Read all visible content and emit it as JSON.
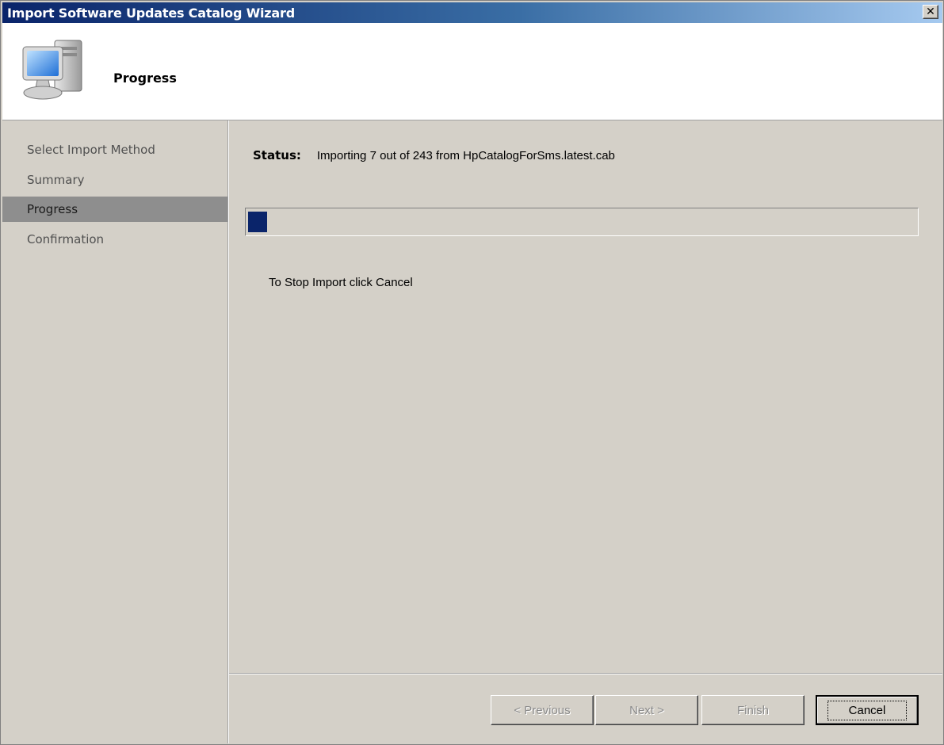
{
  "window": {
    "title": "Import Software Updates Catalog Wizard",
    "close_label": "✕"
  },
  "header": {
    "title": "Progress",
    "icon": "computer-icon"
  },
  "sidebar": {
    "items": [
      {
        "label": "Select Import Method",
        "active": false
      },
      {
        "label": "Summary",
        "active": false
      },
      {
        "label": "Progress",
        "active": true
      },
      {
        "label": "Confirmation",
        "active": false
      }
    ]
  },
  "status": {
    "label": "Status:",
    "text": "Importing  7 out of 243  from HpCatalogForSms.latest.cab",
    "current": 7,
    "total": 243
  },
  "progress": {
    "fraction": 0.0288
  },
  "hint": "To Stop Import click Cancel",
  "buttons": {
    "previous": "< Previous",
    "next": "Next >",
    "finish": "Finish",
    "cancel": "Cancel"
  },
  "colors": {
    "title_bar": "#0a246a",
    "progress_fill": "#0a246a",
    "active_nav": "#8e8e8e"
  }
}
